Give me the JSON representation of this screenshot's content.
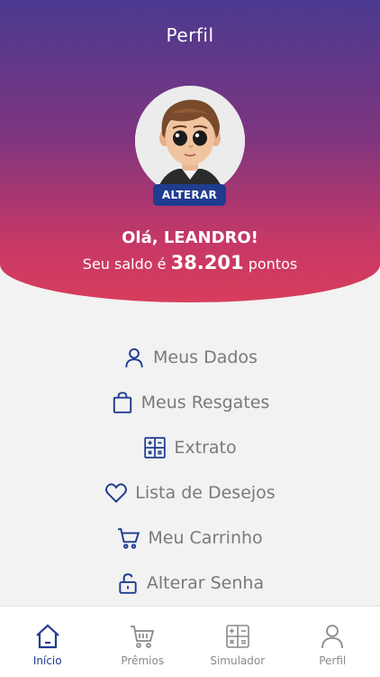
{
  "header": {
    "title": "Perfil",
    "alter_label": "ALTERAR",
    "greeting": "Olá, LEANDRO!",
    "balance_prefix": "Seu saldo é",
    "balance_value": "38.201",
    "balance_suffix": "pontos"
  },
  "menu": {
    "items": [
      {
        "label": "Meus Dados",
        "icon": "user-icon"
      },
      {
        "label": "Meus Resgates",
        "icon": "shopping-bag-icon"
      },
      {
        "label": "Extrato",
        "icon": "calculator-icon"
      },
      {
        "label": "Lista de Desejos",
        "icon": "heart-icon"
      },
      {
        "label": "Meu Carrinho",
        "icon": "cart-icon"
      },
      {
        "label": "Alterar Senha",
        "icon": "unlock-icon"
      }
    ]
  },
  "tabbar": {
    "items": [
      {
        "label": "Início",
        "icon": "home-icon",
        "active": true
      },
      {
        "label": "Prêmios",
        "icon": "cart-icon",
        "active": false
      },
      {
        "label": "Simulador",
        "icon": "calculator-icon",
        "active": false
      },
      {
        "label": "Perfil",
        "icon": "user-icon",
        "active": false
      }
    ]
  },
  "colors": {
    "gradient_top": "#4a3a8f",
    "gradient_bottom": "#d83d5c",
    "accent": "#1f3c8f",
    "menu_text": "#7a7a7a",
    "background": "#f2f2f2"
  }
}
